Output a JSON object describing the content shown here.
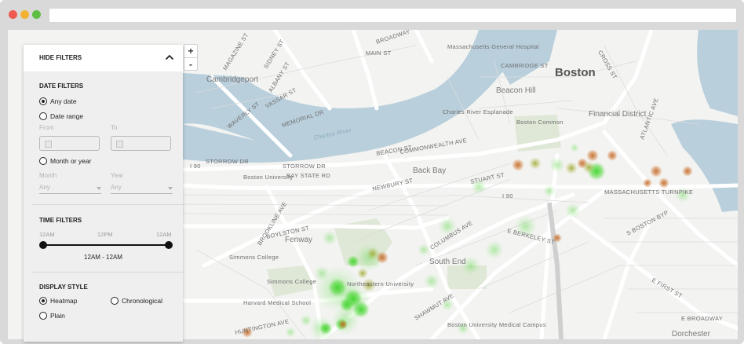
{
  "window": {
    "controls": [
      "close",
      "minimize",
      "maximize"
    ],
    "url": ""
  },
  "map": {
    "zoom_in": "+",
    "zoom_out": "-",
    "labels": {
      "boston": "Boston",
      "beacon_hill": "Beacon Hill",
      "back_bay": "Back Bay",
      "financial_district": "Financial District",
      "fenway": "Fenway",
      "south_end": "South End",
      "cambridgeport": "Cambridgeport",
      "boston_common": "Boston Common",
      "charles_river": "Charles River",
      "charles_river_esplanade": "Charles River Esplanade",
      "boston_university": "Boston University",
      "northeastern_university": "Northeastern University",
      "simmons_college": "Simmons College",
      "simmons_college_2": "Simmons College",
      "harvard_medical_school": "Harvard Medical School",
      "boston_university_medical_campus": "Boston University Medical Campus",
      "mass_general": "Massachusetts General Hospital",
      "dorchester": "Dorchester",
      "storrow_dr": "STORROW DR",
      "storrow_dr_2": "STORROW DR",
      "bay_state_rd": "BAY STATE RD",
      "memorial_dr": "MEMORIAL DR",
      "commonwealth_ave": "COMMONWEALTH AVE",
      "beacon_st": "BEACON ST",
      "newbury_st": "NEWBURY ST",
      "boylston_st": "BOYLSTON ST",
      "stuart_st": "STUART ST",
      "columbus_ave": "COLUMBUS AVE",
      "e_berkeley_st": "E BERKELEY ST",
      "massachusetts_tpke": "MASSACHUSETTS TURNPIKE",
      "huntington_ave": "HUNTINGTON AVE",
      "shawmut_ave": "SHAWMUT AVE",
      "brookline_ave": "BROOKLINE AVE",
      "albany_st": "ALBANY ST",
      "main_st": "MAIN ST",
      "broadway": "BROADWAY",
      "cambridge_st": "CAMBRIDGE ST",
      "vassar_st": "VASSAR ST",
      "waverly_st": "WAVERLY ST",
      "magazine_st": "MAGAZINE ST",
      "sidney_st": "SIDNEY ST",
      "cross_st": "CROSS ST",
      "atlantic_ave": "ATLANTIC AVE",
      "e_first_st": "E FIRST ST",
      "e_broadway": "E BROADWAY",
      "s_boston_byp": "S BOSTON BYP",
      "i90_a": "I 90",
      "i90_b": "I 90"
    }
  },
  "filters": {
    "header": "HIDE FILTERS",
    "date": {
      "title": "DATE FILTERS",
      "options": [
        "Any date",
        "Date range",
        "Month or year"
      ],
      "selected": "Any date",
      "from_label": "From",
      "to_label": "To",
      "month_label": "Month",
      "year_label": "Year",
      "month_value": "Any",
      "year_value": "Any"
    },
    "time": {
      "title": "TIME FILTERS",
      "tick_start": "12AM",
      "tick_mid": "12PM",
      "tick_end": "12AM",
      "range_text": "12AM - 12AM",
      "range_start_fraction": 0,
      "range_end_fraction": 1
    },
    "display": {
      "title": "DISPLAY STYLE",
      "options": [
        "Heatmap",
        "Chronological",
        "Plain"
      ],
      "selected": "Heatmap"
    }
  }
}
